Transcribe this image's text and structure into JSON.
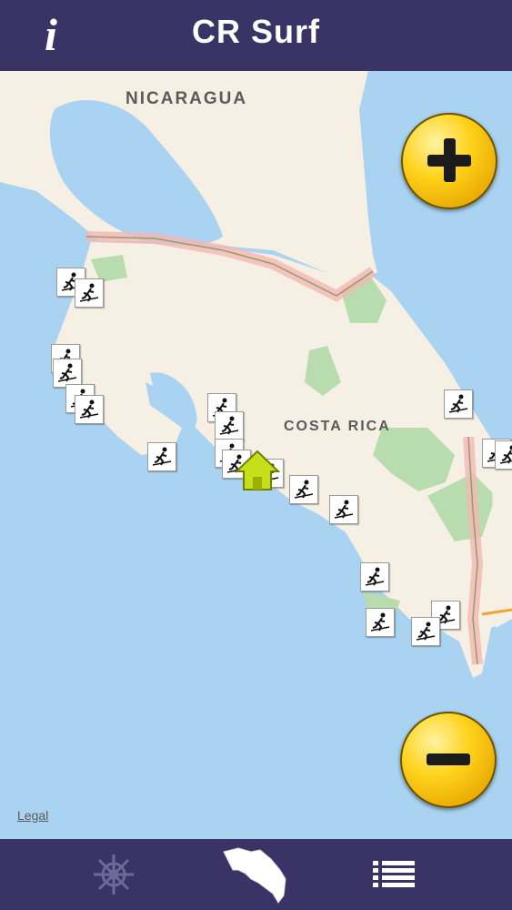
{
  "header": {
    "title": "CR Surf",
    "info_icon": "info-icon"
  },
  "map": {
    "labels": {
      "nicaragua": "NICARAGUA",
      "costa_rica": "COSTA RICA"
    },
    "legal": "Legal",
    "zoom_in_icon": "plus-icon",
    "zoom_out_icon": "minus-icon",
    "surf_spot_icon": "surfer-icon",
    "home_icon": "home-icon",
    "colors": {
      "water": "#a9d3f0",
      "land": "#f6efe4",
      "park": "#b8dcae",
      "border": "#f2b8b4",
      "header": "#3a3466",
      "zoom": "#ffd21a"
    }
  },
  "tabbar": {
    "tabs": [
      {
        "icon": "helm-wheel-icon",
        "active": false
      },
      {
        "icon": "costa-rica-map-icon",
        "active": true
      },
      {
        "icon": "list-icon",
        "active": false
      }
    ]
  }
}
